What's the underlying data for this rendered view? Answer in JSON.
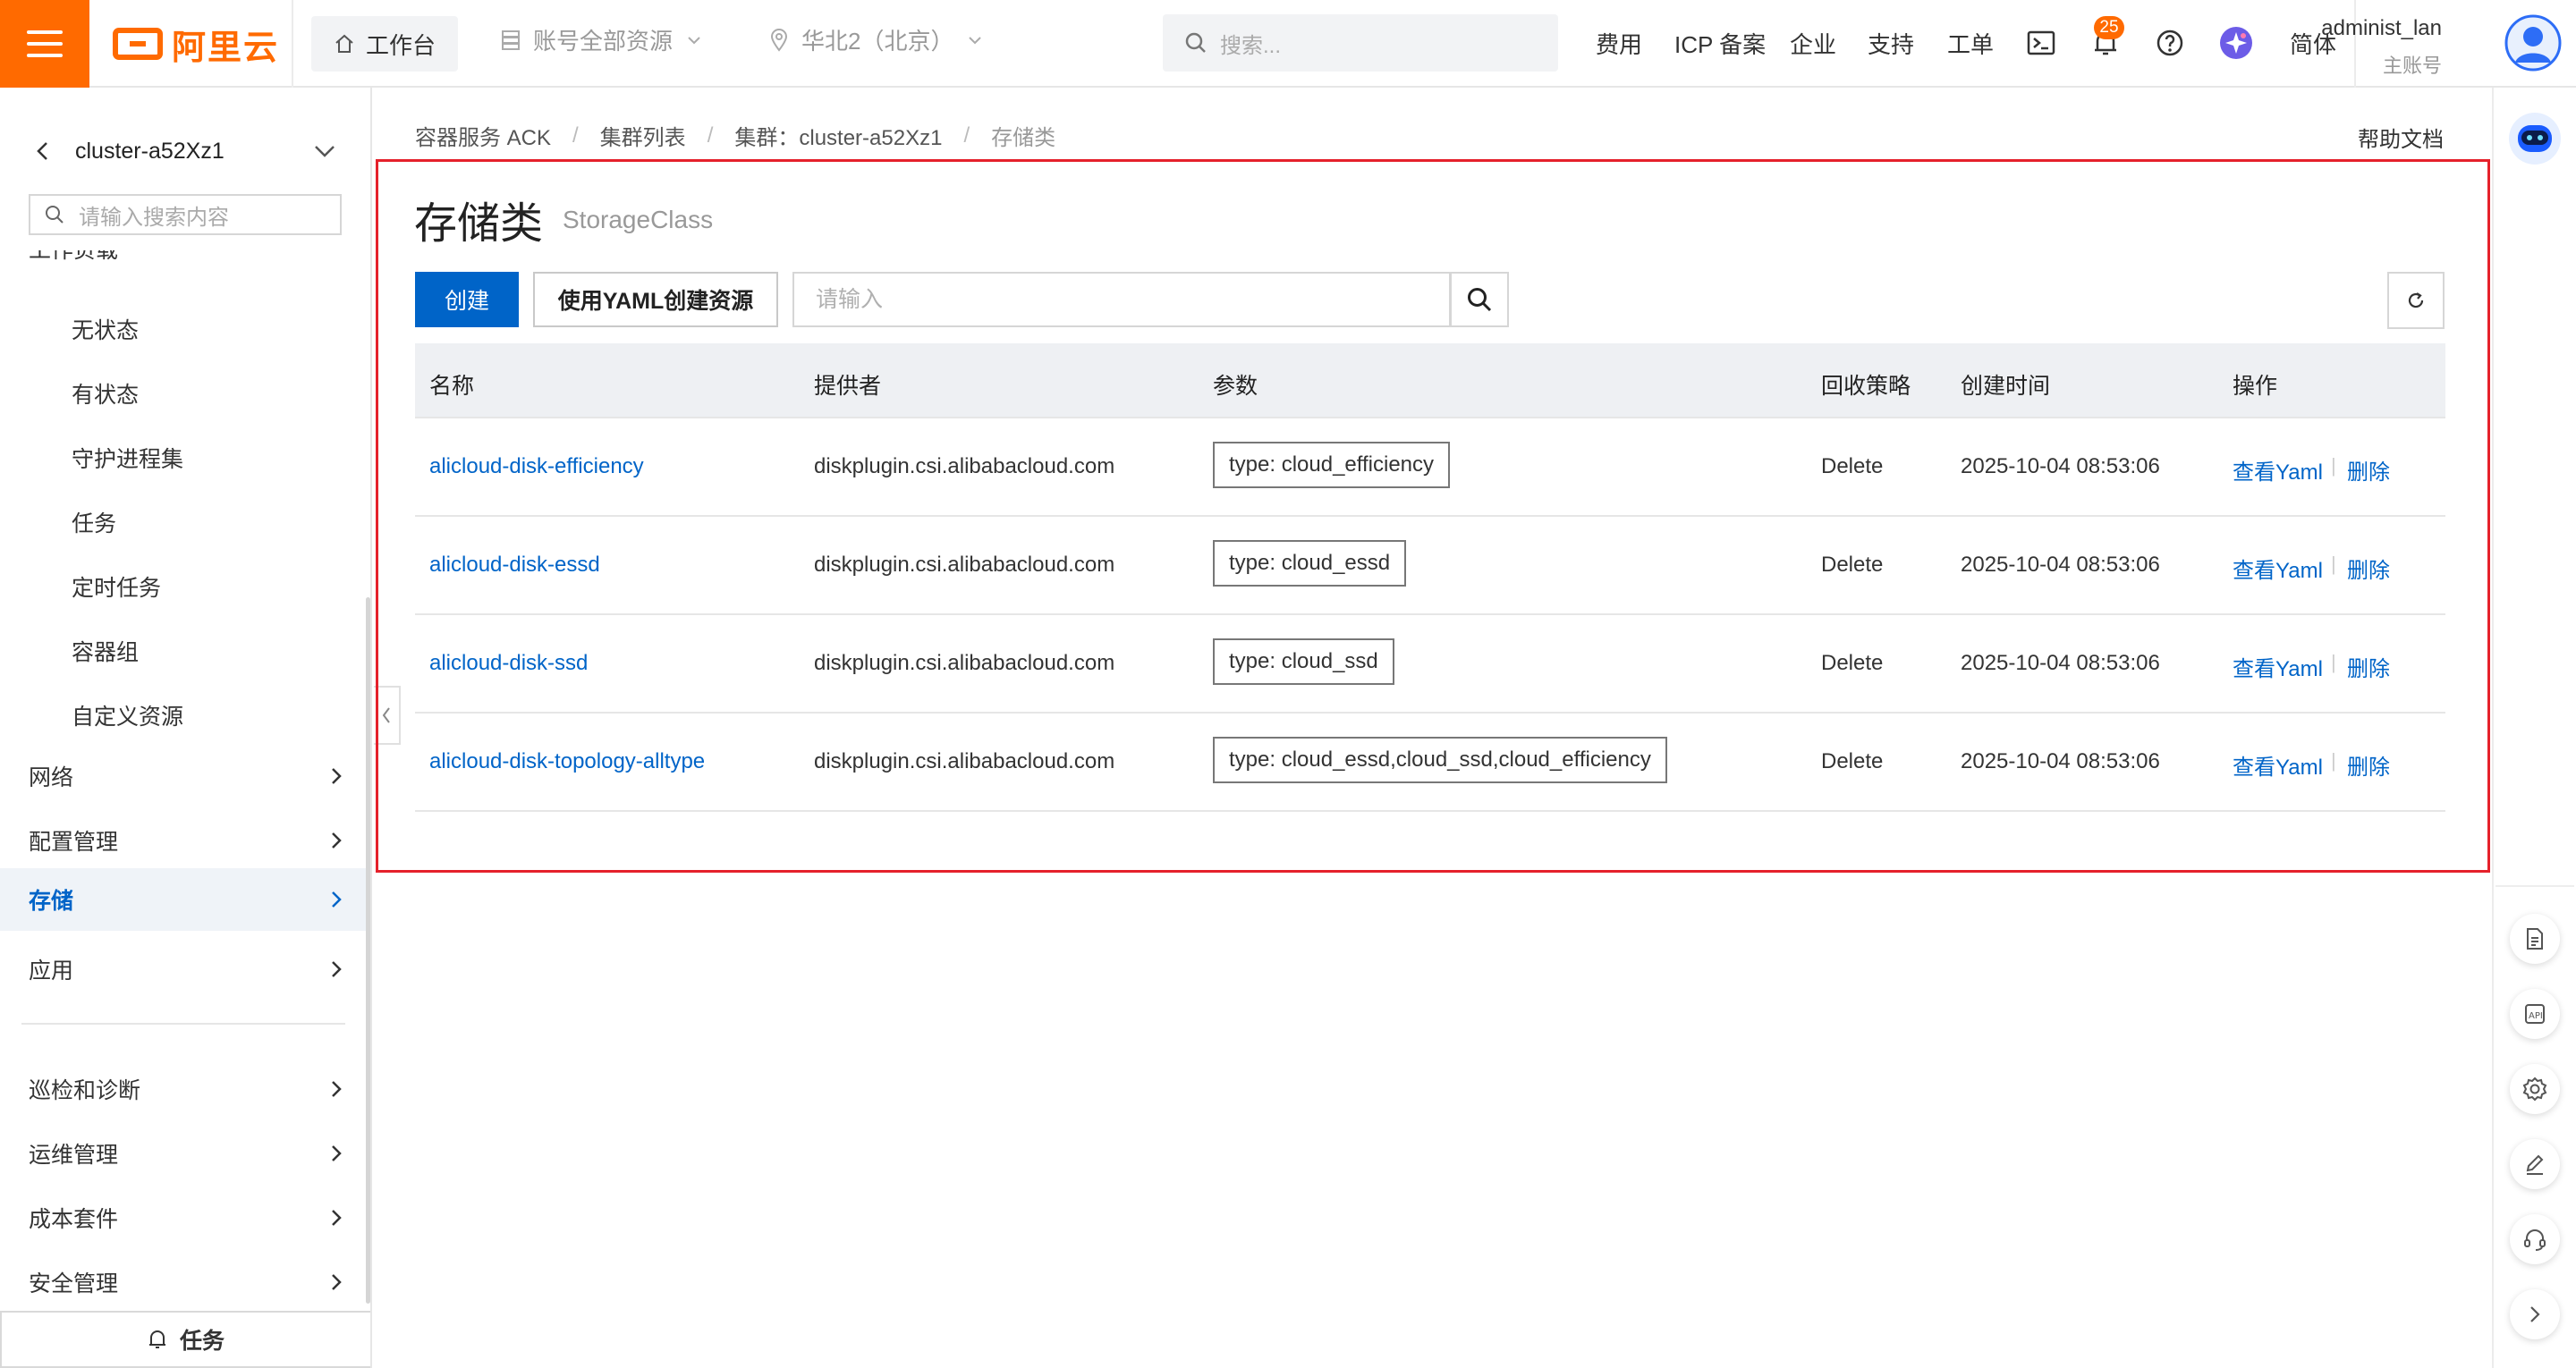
{
  "topbar": {
    "brand": "阿里云",
    "workbench": "工作台",
    "account_scope": "账号全部资源",
    "region": "华北2（北京）",
    "search_placeholder": "搜索...",
    "links": [
      "费用",
      "ICP 备案",
      "企业",
      "支持",
      "工单"
    ],
    "notification_count": "25",
    "language": "简体",
    "user_name": "administ_lan",
    "user_role": "主账号",
    "brand_color": "#ff6a00"
  },
  "sidebar": {
    "cluster_name": "cluster-a52Xz1",
    "search_placeholder": "请输入搜索内容",
    "clipped_group": "工作负载",
    "workload_items": [
      "无状态",
      "有状态",
      "守护进程集",
      "任务",
      "定时任务",
      "容器组",
      "自定义资源"
    ],
    "groups": [
      "网络",
      "配置管理",
      "存储",
      "应用"
    ],
    "active_group": "存储",
    "groups2": [
      "巡检和诊断",
      "运维管理",
      "成本套件",
      "安全管理"
    ],
    "tasks_label": "任务"
  },
  "breadcrumb": [
    "容器服务 ACK",
    "集群列表",
    "集群：cluster-a52Xz1",
    "存储类"
  ],
  "help_doc": "帮助文档",
  "page": {
    "title": "存储类",
    "subtitle": "StorageClass",
    "create_label": "创建",
    "yaml_create_label": "使用YAML创建资源",
    "filter_placeholder": "请输入"
  },
  "table": {
    "columns": [
      "名称",
      "提供者",
      "参数",
      "回收策略",
      "创建时间",
      "操作"
    ],
    "rows": [
      {
        "name": "alicloud-disk-efficiency",
        "provisioner": "diskplugin.csi.alibabacloud.com",
        "params": "type: cloud_efficiency",
        "reclaim": "Delete",
        "created": "2025-10-04 08:53:06"
      },
      {
        "name": "alicloud-disk-essd",
        "provisioner": "diskplugin.csi.alibabacloud.com",
        "params": "type: cloud_essd",
        "reclaim": "Delete",
        "created": "2025-10-04 08:53:06"
      },
      {
        "name": "alicloud-disk-ssd",
        "provisioner": "diskplugin.csi.alibabacloud.com",
        "params": "type: cloud_ssd",
        "reclaim": "Delete",
        "created": "2025-10-04 08:53:06"
      },
      {
        "name": "alicloud-disk-topology-alltype",
        "provisioner": "diskplugin.csi.alibabacloud.com",
        "params": "type: cloud_essd,cloud_ssd,cloud_efficiency",
        "reclaim": "Delete",
        "created": "2025-10-04 08:53:06"
      }
    ],
    "action_view": "查看Yaml",
    "action_delete": "删除",
    "action_sep": "|"
  },
  "colors": {
    "primary": "#0064c8",
    "highlight_border": "#e5212b",
    "active_bg": "#eff3f8"
  }
}
